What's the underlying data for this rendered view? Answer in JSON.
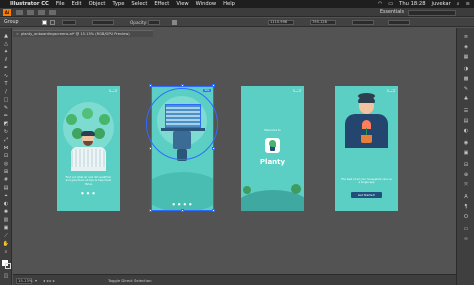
{
  "menubar": {
    "app_name": "Illustrator CC",
    "menus": [
      "File",
      "Edit",
      "Object",
      "Type",
      "Select",
      "Effect",
      "View",
      "Window",
      "Help"
    ],
    "clock": "Thu 18:28",
    "user": "juvekar"
  },
  "appbar": {
    "logo": "Ai",
    "workspace": "Essentials",
    "search_placeholder": ""
  },
  "control": {
    "selection_label": "Group",
    "opacity_label": "Opacity:",
    "stroke_field": "",
    "x_value": "1110.996",
    "y_value": "795.128"
  },
  "document": {
    "tab_title": "planty_onboardingscreens.ai* @ 15.13% (RGB/GPU Preview)"
  },
  "statusbar": {
    "zoom": "15.13%",
    "tool_status": "Toggle Direct Selection"
  },
  "artboards": [
    {
      "skip": "Skip",
      "caption": "Find out what air and dirt wealthier and give them all tips to help them thrive",
      "dots": "● ● ●"
    },
    {
      "skip": "Skip",
      "caption": "",
      "dots": "● ● ● ●"
    },
    {
      "skip": "Skip",
      "welcome": "Welcome to",
      "title": "Planty"
    },
    {
      "skip": "Skip",
      "caption": "The best of all your houseplant care on a single app",
      "button": "Get Started!"
    }
  ],
  "colors": {
    "artboard_bg": "#5ccfc4",
    "accent_orange": "#ff7c00",
    "selection_blue": "#2e6bff",
    "button_dark": "#1f4f7a"
  }
}
